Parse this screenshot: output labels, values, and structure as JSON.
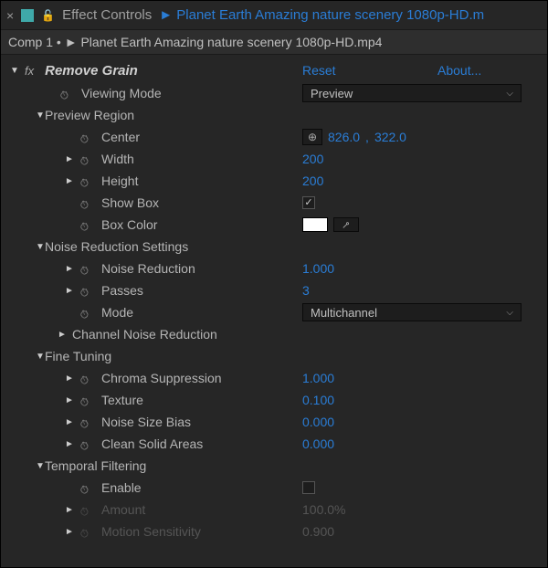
{
  "tab": {
    "title": "Effect Controls",
    "path_prefix": "►",
    "clip_name": "Planet Earth  Amazing nature scenery 1080p-HD.m"
  },
  "breadcrumb": {
    "comp": "Comp 1",
    "sep": " • ►",
    "clip": "Planet Earth  Amazing nature scenery 1080p-HD.mp4"
  },
  "effect": {
    "name": "Remove Grain",
    "reset": "Reset",
    "about": "About...",
    "viewing_mode": {
      "label": "Viewing Mode",
      "value": "Preview"
    },
    "preview_region": {
      "label": "Preview Region",
      "center": {
        "label": "Center",
        "x": "826.0",
        "y": "322.0"
      },
      "width": {
        "label": "Width",
        "value": "200"
      },
      "height": {
        "label": "Height",
        "value": "200"
      },
      "show_box": {
        "label": "Show Box",
        "checked": true
      },
      "box_color": {
        "label": "Box Color",
        "value": "#ffffff"
      }
    },
    "noise_reduction_settings": {
      "label": "Noise Reduction Settings",
      "noise_reduction": {
        "label": "Noise Reduction",
        "value": "1.000"
      },
      "passes": {
        "label": "Passes",
        "value": "3"
      },
      "mode": {
        "label": "Mode",
        "value": "Multichannel"
      },
      "channel_noise_reduction": {
        "label": "Channel Noise Reduction"
      }
    },
    "fine_tuning": {
      "label": "Fine Tuning",
      "chroma_suppression": {
        "label": "Chroma Suppression",
        "value": "1.000"
      },
      "texture": {
        "label": "Texture",
        "value": "0.100"
      },
      "noise_size_bias": {
        "label": "Noise Size Bias",
        "value": "0.000"
      },
      "clean_solid_areas": {
        "label": "Clean Solid Areas",
        "value": "0.000"
      }
    },
    "temporal_filtering": {
      "label": "Temporal Filtering",
      "enable": {
        "label": "Enable",
        "checked": false
      },
      "amount": {
        "label": "Amount",
        "value": "100.0%"
      },
      "motion_sensitivity": {
        "label": "Motion Sensitivity",
        "value": "0.900"
      }
    }
  }
}
